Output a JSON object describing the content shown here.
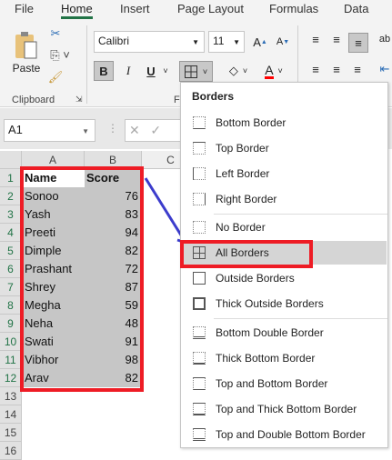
{
  "tabs": [
    "File",
    "Home",
    "Insert",
    "Page Layout",
    "Formulas",
    "Data"
  ],
  "active_tab": "Home",
  "ribbon": {
    "paste_label": "Paste",
    "clipboard_group": "Clipboard",
    "font_group_partial": "F",
    "font_name": "Calibri",
    "font_size": "11",
    "bold": "B",
    "italic": "I",
    "underline": "U",
    "font_color": "#ff0000"
  },
  "name_box": "A1",
  "columns": [
    "A",
    "B",
    "C"
  ],
  "rows": [
    "1",
    "2",
    "3",
    "4",
    "5",
    "6",
    "7",
    "8",
    "9",
    "10",
    "11",
    "12",
    "13",
    "14",
    "15",
    "16"
  ],
  "table": {
    "headers": [
      "Name",
      "Score"
    ],
    "rows": [
      [
        "Sonoo",
        "76"
      ],
      [
        "Yash",
        "83"
      ],
      [
        "Preeti",
        "94"
      ],
      [
        "Dimple",
        "82"
      ],
      [
        "Prashant",
        "72"
      ],
      [
        "Shrey",
        "87"
      ],
      [
        "Megha",
        "59"
      ],
      [
        "Neha",
        "48"
      ],
      [
        "Swati",
        "91"
      ],
      [
        "Vibhor",
        "98"
      ],
      [
        "Arav",
        "82"
      ]
    ]
  },
  "borders_menu": {
    "title": "Borders",
    "items": [
      {
        "label": "Bottom Border",
        "icon": "bottom-border-icon"
      },
      {
        "label": "Top Border",
        "icon": "top-border-icon"
      },
      {
        "label": "Left Border",
        "icon": "left-border-icon"
      },
      {
        "label": "Right Border",
        "icon": "right-border-icon"
      },
      {
        "label": "No Border",
        "icon": "no-border-icon"
      },
      {
        "label": "All Borders",
        "icon": "all-borders-icon",
        "highlighted": true
      },
      {
        "label": "Outside Borders",
        "icon": "outside-borders-icon"
      },
      {
        "label": "Thick Outside Borders",
        "icon": "thick-outside-borders-icon"
      },
      {
        "label": "Bottom Double Border",
        "icon": "bottom-double-border-icon"
      },
      {
        "label": "Thick Bottom Border",
        "icon": "thick-bottom-border-icon"
      },
      {
        "label": "Top and Bottom Border",
        "icon": "top-bottom-border-icon"
      },
      {
        "label": "Top and Thick Bottom Border",
        "icon": "top-thick-bottom-border-icon"
      },
      {
        "label": "Top and Double Bottom Border",
        "icon": "top-double-bottom-border-icon"
      }
    ]
  },
  "colors": {
    "annotation_red": "#ee1c25",
    "annotation_arrow": "#3c3ccc",
    "selection": "#c6c6c6",
    "accent": "#217346"
  }
}
